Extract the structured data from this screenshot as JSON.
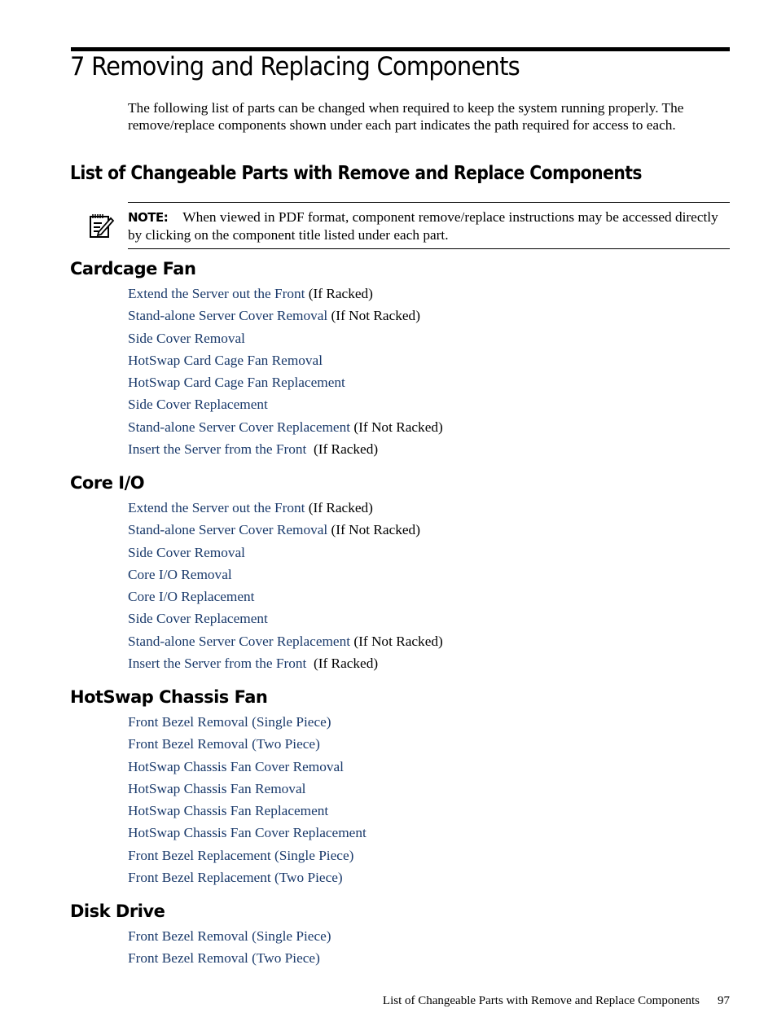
{
  "chapter": {
    "title": "7 Removing and Replacing Components",
    "intro": "The following list of parts can be changed when required to keep the system running properly. The remove/replace components shown under each part indicates the path required for access to each."
  },
  "section": {
    "title": "List of Changeable Parts with Remove and Replace Components"
  },
  "note": {
    "icon": "note-pencil-icon",
    "label": "NOTE:",
    "text": "When viewed in PDF format, component remove/replace instructions may be accessed directly by clicking on the component title listed under each part."
  },
  "parts": [
    {
      "title": "Cardcage Fan",
      "steps": [
        {
          "link": "Extend the Server out the Front",
          "condition": " (If Racked)"
        },
        {
          "link": "Stand-alone Server Cover Removal",
          "condition": " (If Not Racked)"
        },
        {
          "link": "Side Cover Removal",
          "condition": ""
        },
        {
          "link": "HotSwap Card Cage Fan Removal",
          "condition": ""
        },
        {
          "link": "HotSwap Card Cage Fan Replacement",
          "condition": ""
        },
        {
          "link": "Side Cover Replacement",
          "condition": ""
        },
        {
          "link": "Stand-alone Server Cover Replacement",
          "condition": " (If Not Racked)"
        },
        {
          "link": "Insert the Server from the Front",
          "condition": "  (If Racked)"
        }
      ]
    },
    {
      "title": "Core I/O",
      "steps": [
        {
          "link": "Extend the Server out the Front",
          "condition": " (If Racked)"
        },
        {
          "link": "Stand-alone Server Cover Removal",
          "condition": " (If Not Racked)"
        },
        {
          "link": "Side Cover Removal",
          "condition": ""
        },
        {
          "link": "Core I/O Removal",
          "condition": ""
        },
        {
          "link": "Core I/O Replacement",
          "condition": ""
        },
        {
          "link": "Side Cover Replacement",
          "condition": ""
        },
        {
          "link": "Stand-alone Server Cover Replacement",
          "condition": " (If Not Racked)"
        },
        {
          "link": "Insert the Server from the Front",
          "condition": "  (If Racked)"
        }
      ]
    },
    {
      "title": "HotSwap Chassis Fan",
      "steps": [
        {
          "link": "Front Bezel Removal (Single Piece)",
          "condition": ""
        },
        {
          "link": "Front Bezel Removal (Two Piece)",
          "condition": ""
        },
        {
          "link": "HotSwap Chassis Fan Cover Removal",
          "condition": ""
        },
        {
          "link": "HotSwap Chassis Fan Removal",
          "condition": ""
        },
        {
          "link": "HotSwap Chassis Fan Replacement",
          "condition": ""
        },
        {
          "link": "HotSwap Chassis Fan Cover Replacement",
          "condition": ""
        },
        {
          "link": "Front Bezel Replacement (Single Piece)",
          "condition": ""
        },
        {
          "link": "Front Bezel Replacement (Two Piece)",
          "condition": ""
        }
      ]
    },
    {
      "title": "Disk Drive",
      "steps": [
        {
          "link": "Front Bezel Removal (Single Piece)",
          "condition": ""
        },
        {
          "link": "Front Bezel Removal (Two Piece)",
          "condition": ""
        }
      ]
    }
  ],
  "footer": {
    "running_title": "List of Changeable Parts with Remove and Replace Components",
    "page_number": "97"
  },
  "colors": {
    "link": "#1a3a6b",
    "text": "#000000"
  }
}
